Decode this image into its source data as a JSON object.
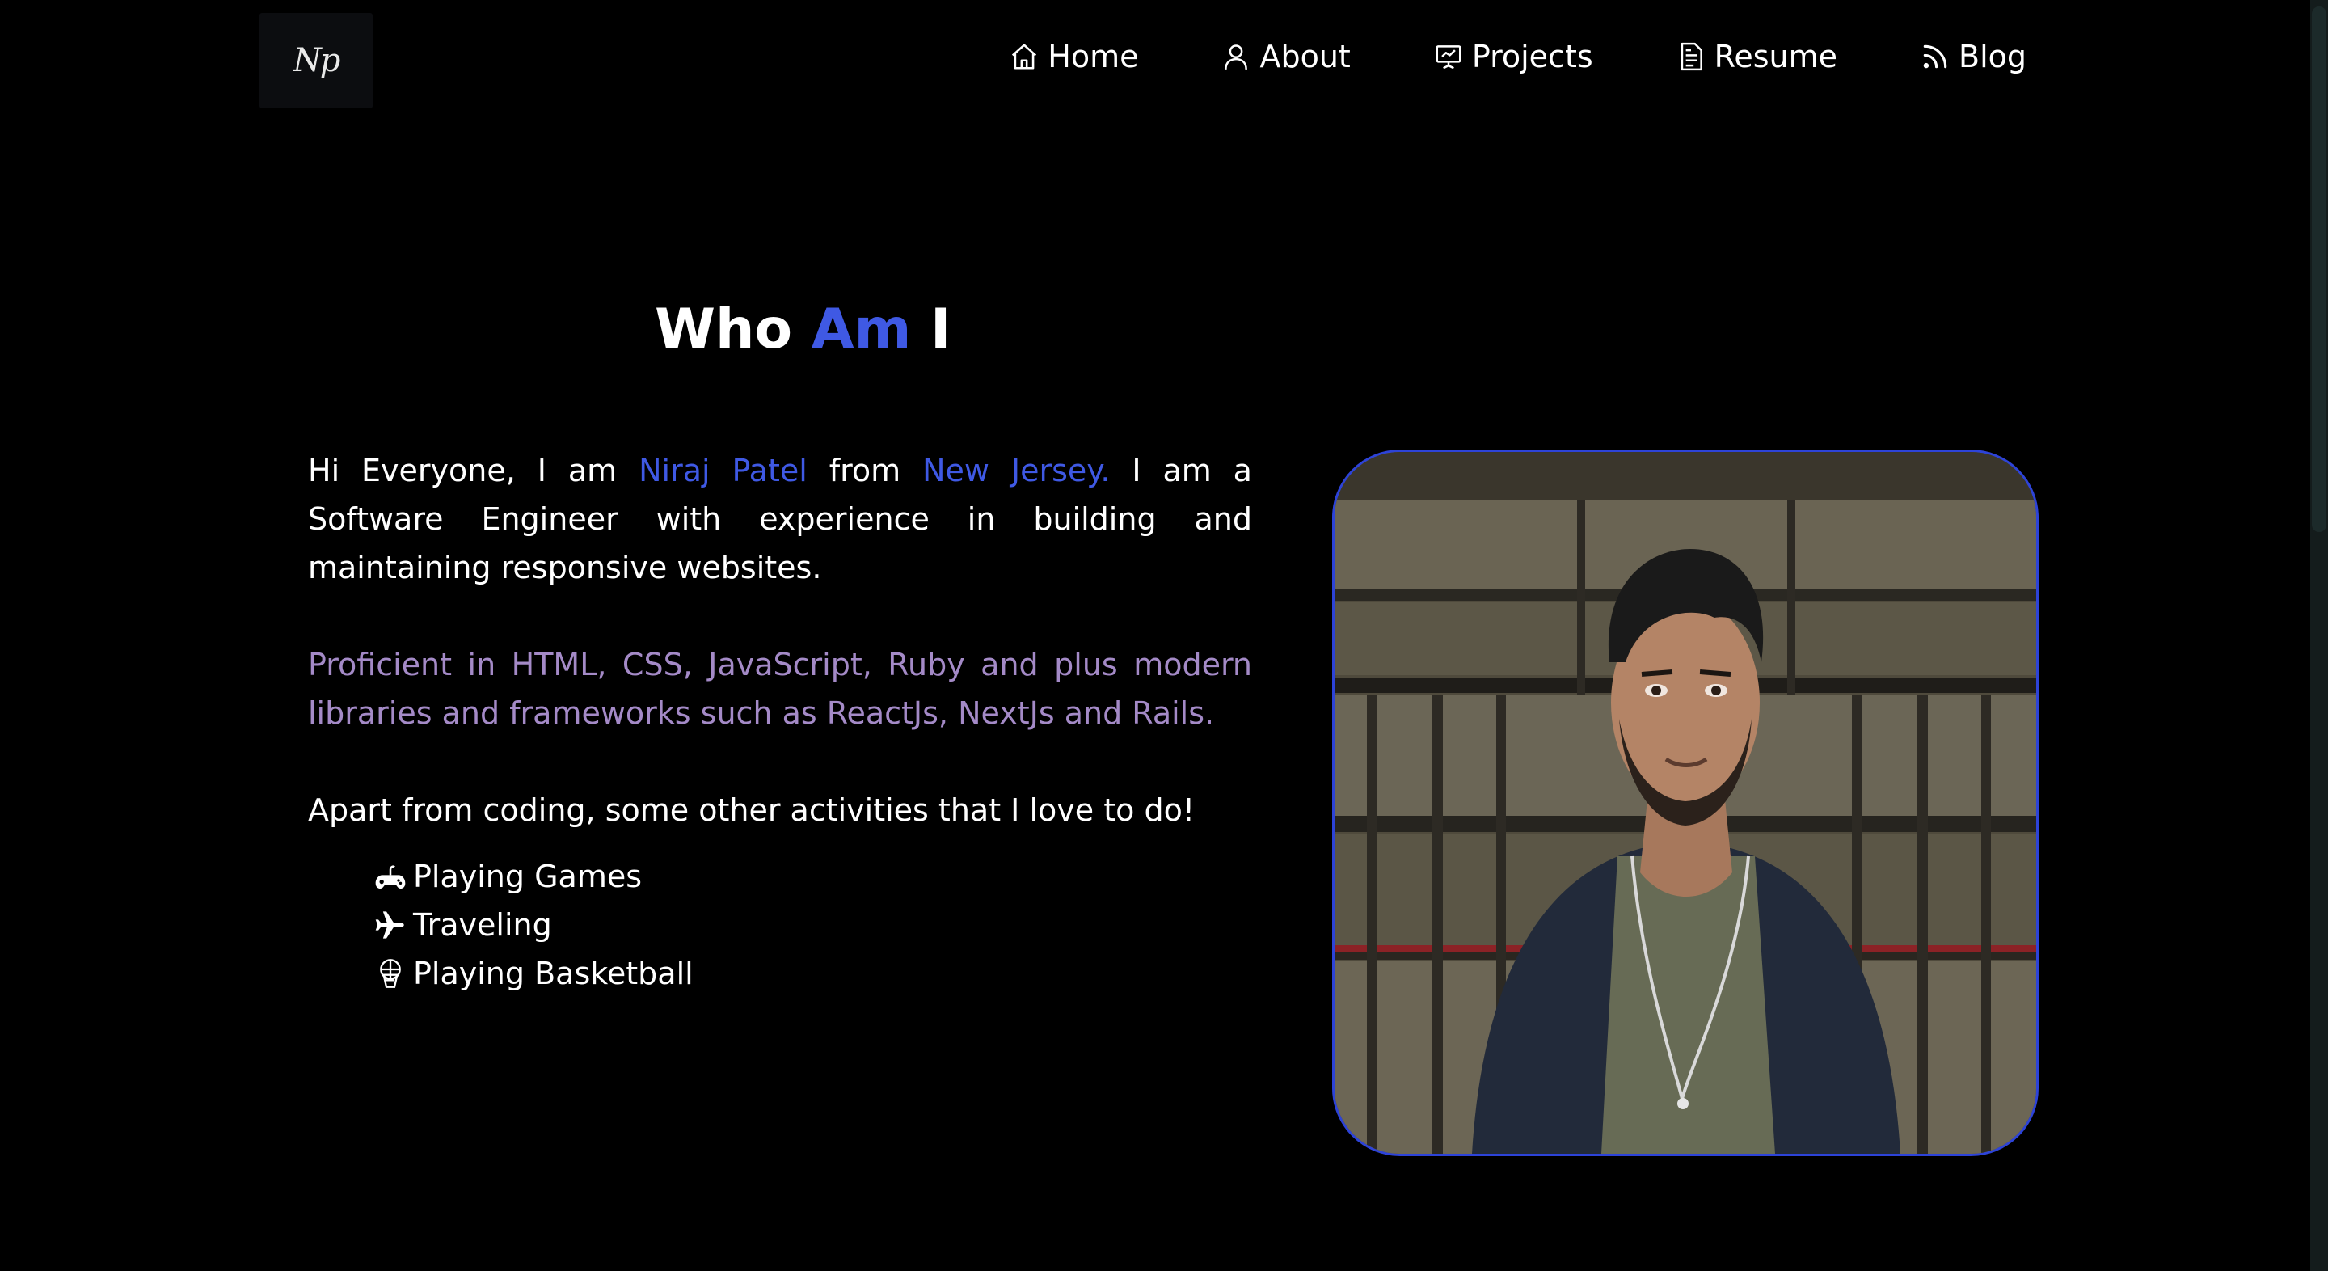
{
  "brand": {
    "logo_text": "Np"
  },
  "nav": {
    "items": [
      {
        "label": "Home",
        "icon": "home-icon"
      },
      {
        "label": "About",
        "icon": "user-icon"
      },
      {
        "label": "Projects",
        "icon": "presentation-icon"
      },
      {
        "label": "Resume",
        "icon": "document-icon"
      },
      {
        "label": "Blog",
        "icon": "rss-icon"
      }
    ]
  },
  "about": {
    "heading_pre": "Who",
    "heading_accent": "Am",
    "heading_post": "I",
    "intro_1": "Hi Everyone, I am",
    "name": "Niraj Patel",
    "intro_2": "from",
    "location": "New Jersey.",
    "intro_3": "I am a Software Engineer with experience in building and maintaining responsive websites.",
    "skills": "Proficient in HTML, CSS, JavaScript, Ruby and plus modern libraries and frameworks such as ReactJs, NextJs and Rails.",
    "activities_intro": "Apart from coding, some other activities that I love to do!",
    "activities": [
      {
        "label": "Playing Games",
        "icon": "gamepad-icon"
      },
      {
        "label": "Traveling",
        "icon": "airplane-icon"
      },
      {
        "label": "Playing Basketball",
        "icon": "basketball-hoop-icon"
      }
    ]
  },
  "colors": {
    "background": "#000000",
    "accent_blue": "#3f59e4",
    "skills_purple": "#a48ac7",
    "photo_border": "#2d43d8"
  }
}
